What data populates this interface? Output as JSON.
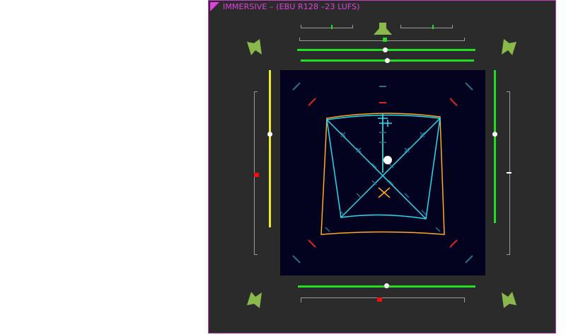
{
  "panel": {
    "title": "IMMERSIVE – (EBU R128 –23 LUFS)"
  },
  "colors": {
    "border": "#c040c0",
    "title": "#e040e0",
    "panel_bg": "#2b2b2b",
    "radar_bg": "#03031f",
    "meter_green": "#22dd22",
    "meter_yellow": "#eeee22",
    "alert_red": "#ee1111",
    "speaker_green": "#8ab84a",
    "front_outline": "#ffaa22",
    "rear_outline": "#22ddee"
  },
  "icons": {
    "speaker_top": "speaker-center-icon",
    "speaker_front_left": "speaker-front-left-icon",
    "speaker_front_right": "speaker-front-right-icon",
    "speaker_rear_left": "speaker-rear-left-icon",
    "speaker_rear_right": "speaker-rear-right-icon"
  }
}
